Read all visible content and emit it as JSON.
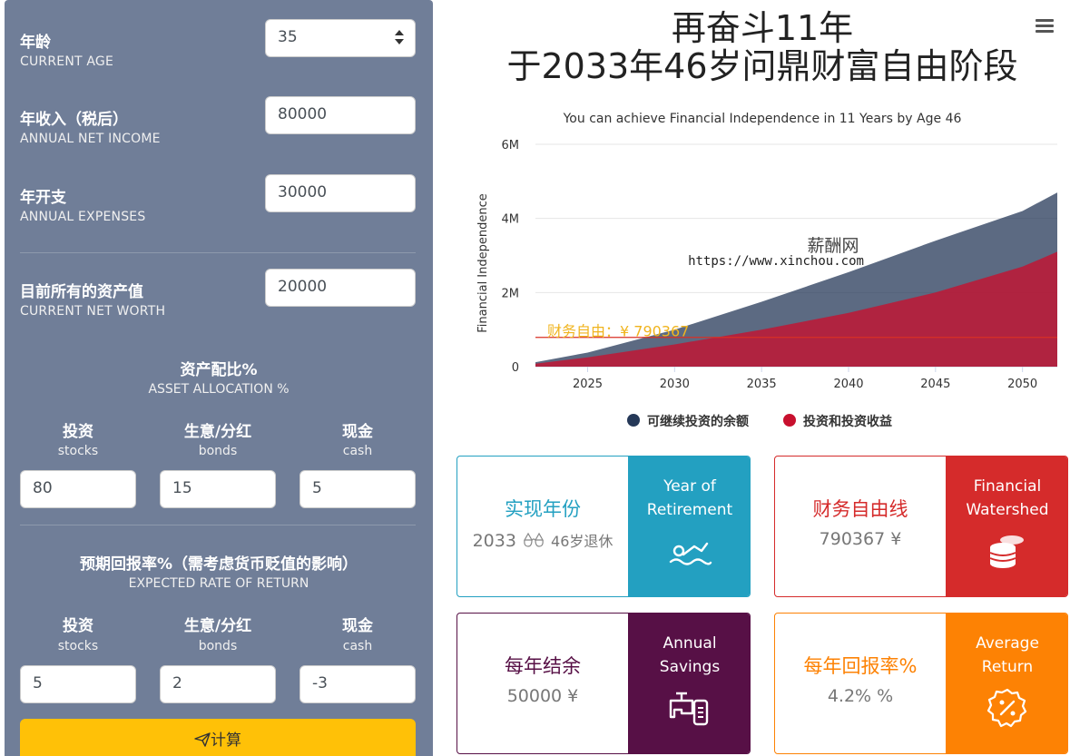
{
  "form": {
    "age": {
      "label": "年龄",
      "sub": "CURRENT AGE",
      "value": "35"
    },
    "income": {
      "label": "年收入（税后）",
      "sub": "ANNUAL NET INCOME",
      "value": "80000"
    },
    "expenses": {
      "label": "年开支",
      "sub": "ANNUAL EXPENSES",
      "value": "30000"
    },
    "networth": {
      "label": "目前所有的资产值",
      "sub": "CURRENT NET WORTH",
      "value": "20000"
    },
    "allocation": {
      "title": "资产配比%",
      "sub": "ASSET ALLOCATION %",
      "cols": [
        {
          "label": "投资",
          "sub": "stocks",
          "value": "80"
        },
        {
          "label": "生意/分红",
          "sub": "bonds",
          "value": "15"
        },
        {
          "label": "现金",
          "sub": "cash",
          "value": "5"
        }
      ]
    },
    "returns": {
      "title": "预期回报率%（需考虑货币贬值的影响）",
      "sub": "EXPECTED RATE OF RETURN",
      "cols": [
        {
          "label": "投资",
          "sub": "stocks",
          "value": "5"
        },
        {
          "label": "生意/分红",
          "sub": "bonds",
          "value": "2"
        },
        {
          "label": "现金",
          "sub": "cash",
          "value": "-3"
        }
      ]
    },
    "calc_label": "计算"
  },
  "headline": {
    "line1": "再奋斗11年",
    "line2": "于2033年46岁问鼎财富自由阶段"
  },
  "chart_data": {
    "type": "area",
    "title": "You can achieve Financial Independence in 11 Years by Age 46",
    "ylabel": "Financial Independence",
    "xlim": [
      2022,
      2052
    ],
    "ylim": [
      0,
      6000000
    ],
    "xticks": [
      "2025",
      "2030",
      "2035",
      "2040",
      "2045",
      "2050"
    ],
    "yticks": [
      "0",
      "2M",
      "4M",
      "6M"
    ],
    "x": [
      2022,
      2025,
      2030,
      2035,
      2040,
      2045,
      2050,
      2052
    ],
    "series": [
      {
        "name": "可继续投资的余额",
        "color": "#253858",
        "values": [
          120000,
          380000,
          1000000,
          1750000,
          2550000,
          3400000,
          4200000,
          4700000
        ]
      },
      {
        "name": "投资和投资收益",
        "color": "#c8102e",
        "values": [
          80000,
          250000,
          600000,
          1000000,
          1450000,
          2000000,
          2700000,
          3100000
        ]
      }
    ],
    "threshold": {
      "label": "财务自由：¥ 790367",
      "value": 790367,
      "color": "#d93025"
    },
    "watermark": {
      "line1": "薪酬网",
      "line2": "https://www.xinchou.com"
    },
    "legend_position": "bottom"
  },
  "cards": {
    "retire": {
      "title": "实现年份",
      "value": "2033",
      "value2": "46岁退休",
      "rtitle1": "Year of",
      "rtitle2": "Retirement",
      "color": "#23a0c1"
    },
    "watershed": {
      "title": "财务自由线",
      "value": "790367 ¥",
      "rtitle1": "Financial",
      "rtitle2": "Watershed",
      "color": "#d52b2b"
    },
    "savings": {
      "title": "每年结余",
      "value": "50000 ¥",
      "rtitle1": "Annual",
      "rtitle2": "Savings",
      "color": "#571046"
    },
    "returnc": {
      "title": "每年回报率%",
      "value": "4.2% %",
      "rtitle1": "Average",
      "rtitle2": "Return",
      "color": "#fd8204"
    }
  }
}
